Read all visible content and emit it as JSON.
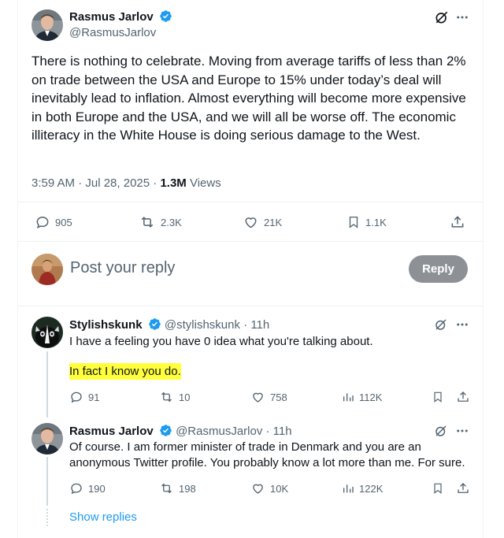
{
  "main_tweet": {
    "author_name": "Rasmus Jarlov",
    "author_handle": "@RasmusJarlov",
    "text": "There is nothing to celebrate. Moving from average tariffs of less than 2% on trade between the USA and Europe to 15% under today’s deal will inevitably lead to inflation. Almost everything will become more expensive in both Europe and the USA, and we will all be worse off. The economic illiteracy in the White House is doing serious damage to the West.",
    "timestamp": "3:59 AM · Jul 28, 2025 · ",
    "views_count": "1.3M",
    "views_label": " Views",
    "replies": "905",
    "reposts": "2.3K",
    "likes": "21K",
    "bookmarks": "1.1K"
  },
  "reply_box": {
    "placeholder": "Post your reply",
    "button_label": "Reply"
  },
  "replies": [
    {
      "author_name": "Stylishskunk",
      "author_handle": "@stylishskunk",
      "time": " · 11h",
      "line1": "I have a feeling you have 0 idea what you're talking about.",
      "line2": "In fact I know you do.",
      "replies": "91",
      "reposts": "10",
      "likes": "758",
      "views": "112K"
    },
    {
      "author_name": "Rasmus Jarlov",
      "author_handle": "@RasmusJarlov",
      "time": " · 11h",
      "line1": "Of course. I am former minister of trade in Denmark and you are an",
      "line2": "anonymous Twitter profile. You probably know a lot more than me. For sure.",
      "replies": "190",
      "reposts": "198",
      "likes": "10K",
      "views": "122K"
    }
  ],
  "show_replies_label": "Show replies",
  "colors": {
    "accent": "#1d9bf0",
    "muted": "#536471",
    "text": "#0f1419",
    "highlight": "#ffff3b"
  }
}
